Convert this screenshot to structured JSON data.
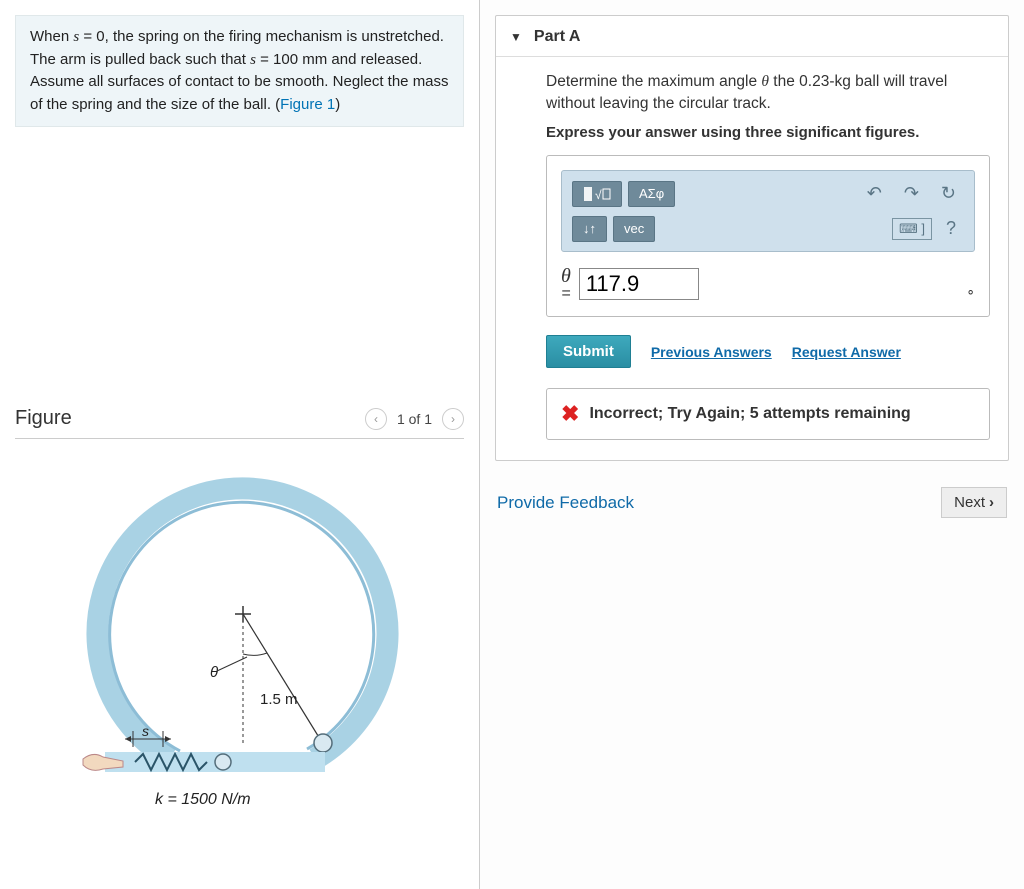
{
  "problem": {
    "text_before": "When ",
    "var1": "s",
    "eq1": " = 0, the spring on the firing mechanism is unstretched. The arm is pulled back such that ",
    "var2": "s",
    "eq2": " = 100 mm and released. Assume all surfaces of contact to be smooth. Neglect the mass of the spring and the size of the ball. (",
    "figlink": "Figure 1",
    "after": ")"
  },
  "figure": {
    "heading": "Figure",
    "pager": "1 of 1",
    "radius_label": "1.5 m",
    "theta_label": "θ",
    "s_label": "s",
    "k_label": "k = 1500 N/m"
  },
  "part": {
    "title": "Part A",
    "question_a": "Determine the maximum angle ",
    "theta": "θ",
    "question_b": " the 0.23-kg ball will travel without leaving the circular track.",
    "instruct": "Express your answer using three significant figures.",
    "toolbar": {
      "templates_label": "ΑΣφ",
      "vec_label": "vec",
      "help_label": "?"
    },
    "answer_var": "θ",
    "equals": "=",
    "answer_value": "117.9",
    "unit_mark": "∘",
    "submit_label": "Submit",
    "prev_answers": "Previous Answers",
    "request_answer": "Request Answer",
    "feedback": "Incorrect; Try Again; 5 attempts remaining"
  },
  "footer": {
    "provide_feedback": "Provide Feedback",
    "next_label": "Next"
  }
}
